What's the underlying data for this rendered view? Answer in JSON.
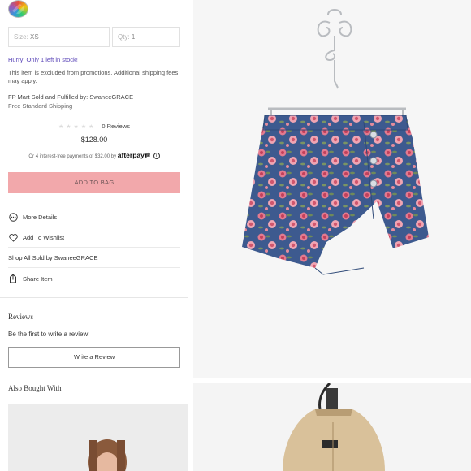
{
  "product": {
    "size_label": "Size:",
    "size_value": "XS",
    "qty_label": "Qty:",
    "qty_value": "1",
    "stock_notice": "Hurry! Only 1 left in stock!",
    "promo_notice": "This item is excluded from promotions. Additional shipping fees may apply.",
    "fulfilled_by": "FP Mart Sold and Fulfilled by: SwaneeGRACE",
    "shipping": "Free Standard Shipping",
    "reviews_count": "0 Reviews",
    "rating_stars": 0,
    "price": "$128.00",
    "afterpay_text": "Or 4 interest-free payments of $32.00 by",
    "afterpay_brand": "afterpay",
    "add_to_bag": "ADD TO BAG"
  },
  "actions": {
    "more_details": "More Details",
    "add_to_wishlist": "Add To Wishlist",
    "shop_all": "Shop All Sold by SwaneeGRACE",
    "share_item": "Share Item"
  },
  "reviews": {
    "heading": "Reviews",
    "first_prompt": "Be the first to write a review!",
    "write_button": "Write a Review"
  },
  "also_bought": {
    "heading": "Also Bought With"
  },
  "icons": {
    "swatch": "rainbow-swatch-icon",
    "more_details": "ellipsis-circle-icon",
    "wishlist": "heart-icon",
    "share": "share-icon",
    "info": "info-icon"
  },
  "colors": {
    "accent_pink": "#f2a8ab",
    "stock_purple": "#5b46b8"
  }
}
